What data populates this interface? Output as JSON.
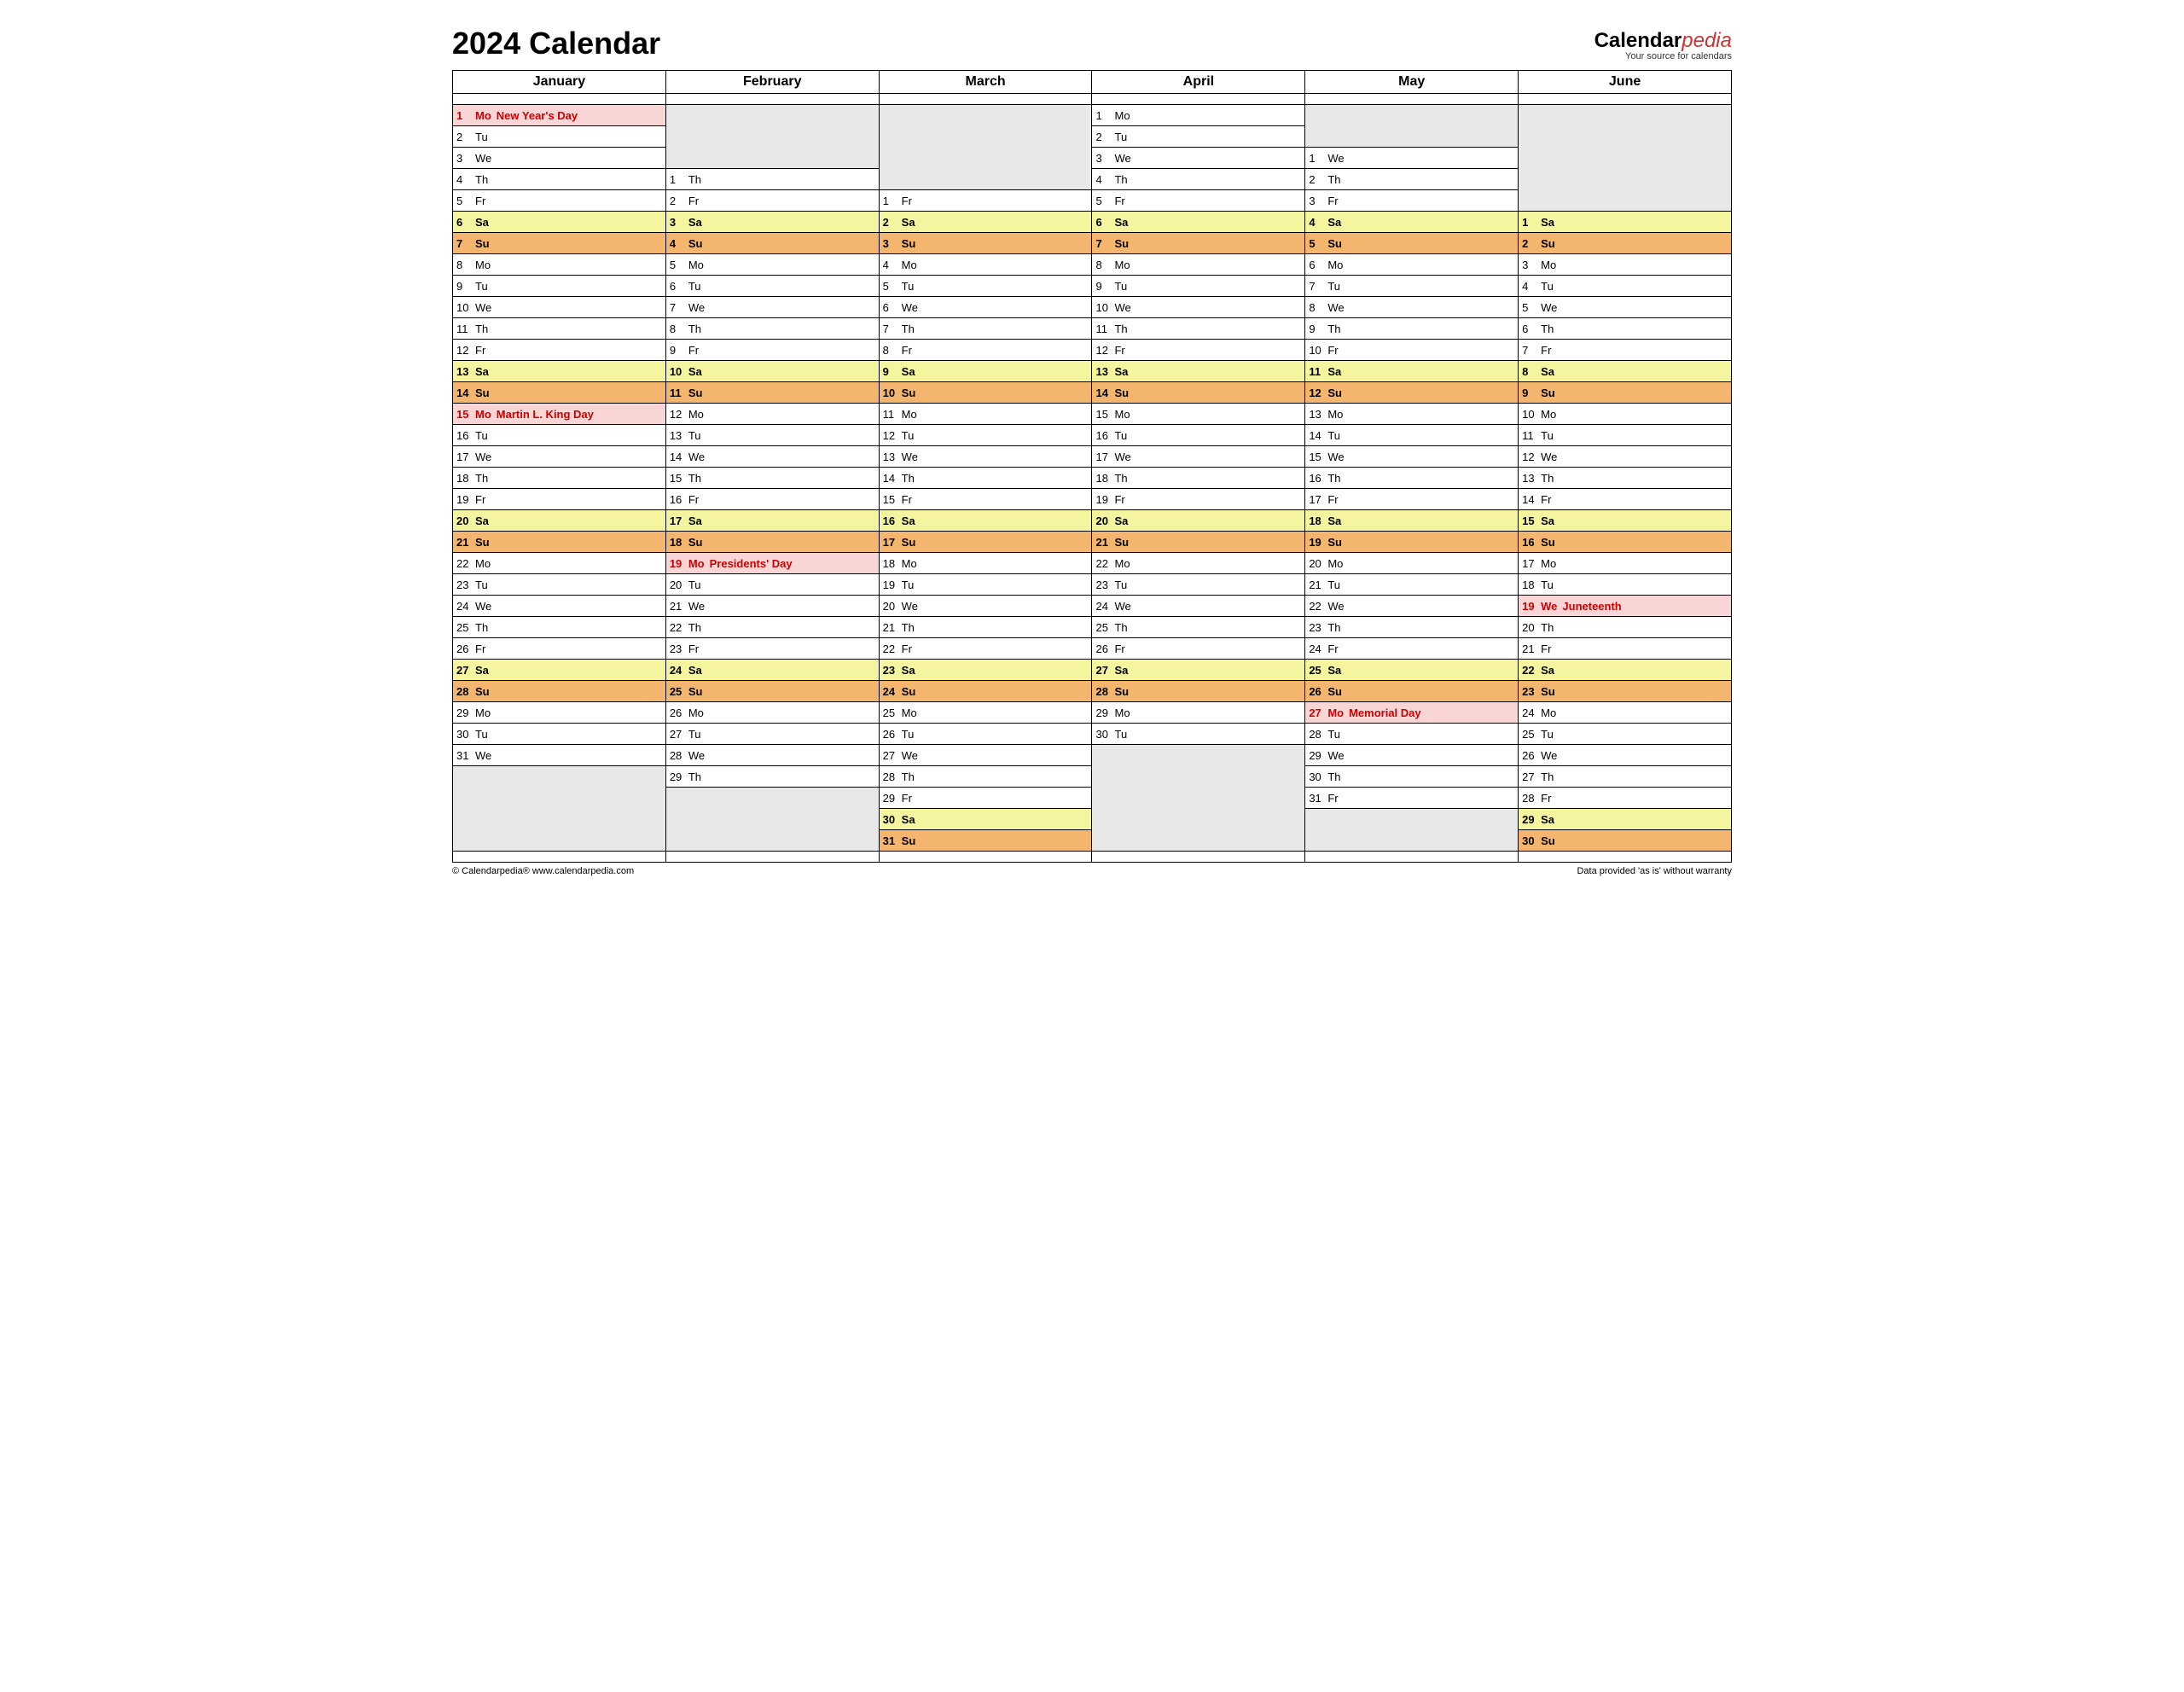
{
  "title": "2024 Calendar",
  "logo": {
    "brand": "Calendar",
    "suffix": "pedia",
    "tagline": "Your source for calendars"
  },
  "footer": {
    "left": "© Calendarpedia®    www.calendarpedia.com",
    "right": "Data provided 'as is' without warranty"
  },
  "days": [
    "Mo",
    "Tu",
    "We",
    "Th",
    "Fr",
    "Sa",
    "Su"
  ],
  "months": [
    {
      "name": "January",
      "offset": 0,
      "ndays": 31,
      "events": {
        "1": "New Year's Day",
        "15": "Martin L. King Day"
      },
      "hol": [
        1,
        15
      ]
    },
    {
      "name": "February",
      "offset": 3,
      "ndays": 29,
      "events": {
        "19": "Presidents' Day"
      },
      "hol": [
        19
      ]
    },
    {
      "name": "March",
      "offset": 4,
      "ndays": 31,
      "events": {},
      "hol": []
    },
    {
      "name": "April",
      "offset": 0,
      "ndays": 30,
      "events": {},
      "hol": []
    },
    {
      "name": "May",
      "offset": 2,
      "ndays": 31,
      "events": {
        "27": "Memorial Day"
      },
      "hol": [
        27
      ]
    },
    {
      "name": "June",
      "offset": 5,
      "ndays": 30,
      "events": {
        "19": "Juneteenth"
      },
      "hol": [
        19
      ]
    }
  ]
}
